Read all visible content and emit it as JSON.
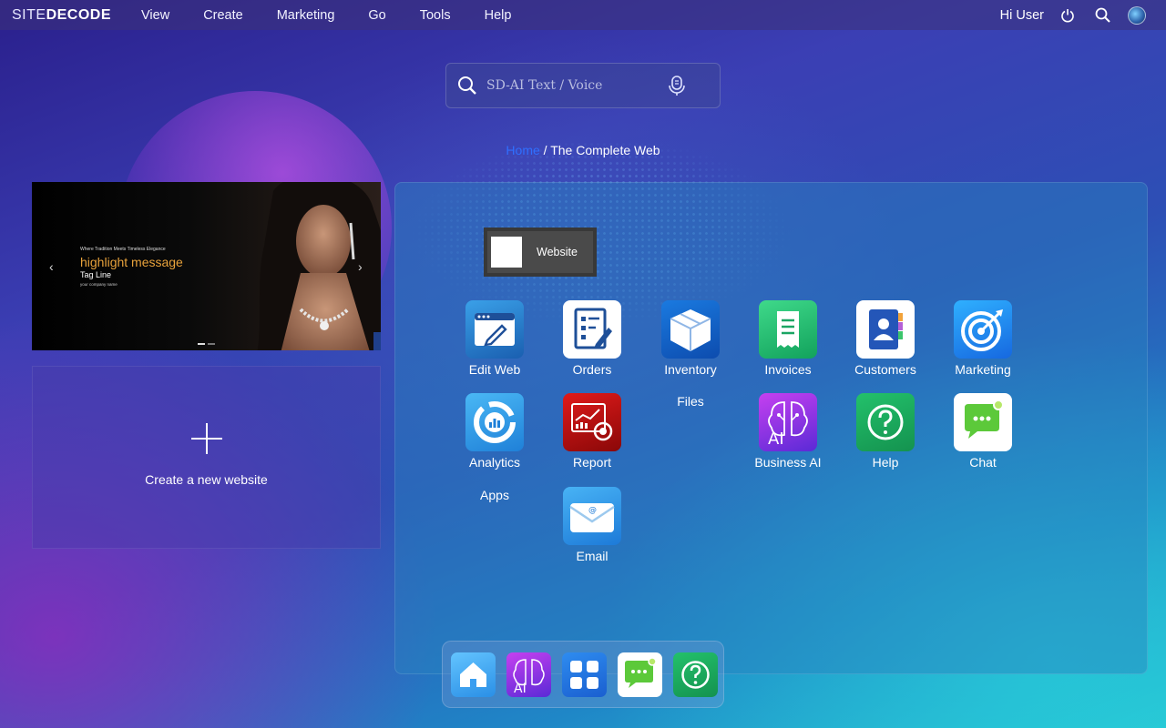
{
  "logo": {
    "part1": "SITE",
    "part2": "DECODE"
  },
  "menu": [
    "View",
    "Create",
    "Marketing",
    "Go",
    "Tools",
    "Help"
  ],
  "user": {
    "greeting": "Hi User"
  },
  "search": {
    "placeholder": "SD-AI Text / Voice"
  },
  "breadcrumb": {
    "home": "Home",
    "separator": "/",
    "current": "The Complete Web"
  },
  "banner": {
    "small_text": "Where Tradition Meets Timeless Elegance",
    "highlight": "highlight message",
    "tagline": "Tag Line",
    "company": "your company name"
  },
  "create_site": {
    "label": "Create a new website"
  },
  "panel": {
    "website_chip": "Website",
    "apps": [
      {
        "label": "Edit Web",
        "icon": "edit-web-icon"
      },
      {
        "label": "Orders",
        "icon": "orders-icon"
      },
      {
        "label": "Inventory",
        "icon": "inventory-box-icon"
      },
      {
        "label": "Invoices",
        "icon": "invoice-icon"
      },
      {
        "label": "Customers",
        "icon": "customers-icon"
      },
      {
        "label": "Marketing",
        "icon": "target-icon"
      },
      {
        "label": "Analytics",
        "icon": "analytics-icon"
      },
      {
        "label": "Report",
        "icon": "report-icon"
      },
      {
        "label": "Business AI",
        "icon": "ai-brain-icon",
        "badge": "AI"
      },
      {
        "label": "Help",
        "icon": "help-icon"
      },
      {
        "label": "Chat",
        "icon": "chat-icon"
      },
      {
        "label": "Email",
        "icon": "email-icon"
      }
    ],
    "group_labels": {
      "files": "Files",
      "apps": "Apps"
    }
  },
  "dock": {
    "items": [
      {
        "icon": "home-icon"
      },
      {
        "icon": "ai-brain-icon",
        "badge": "AI"
      },
      {
        "icon": "apps-grid-icon"
      },
      {
        "icon": "chat-icon"
      },
      {
        "icon": "help-icon"
      }
    ]
  },
  "colors": {
    "breadcrumb_home": "#2f6fff",
    "highlight": "#e8a23b",
    "menubar": "#3c3278"
  }
}
